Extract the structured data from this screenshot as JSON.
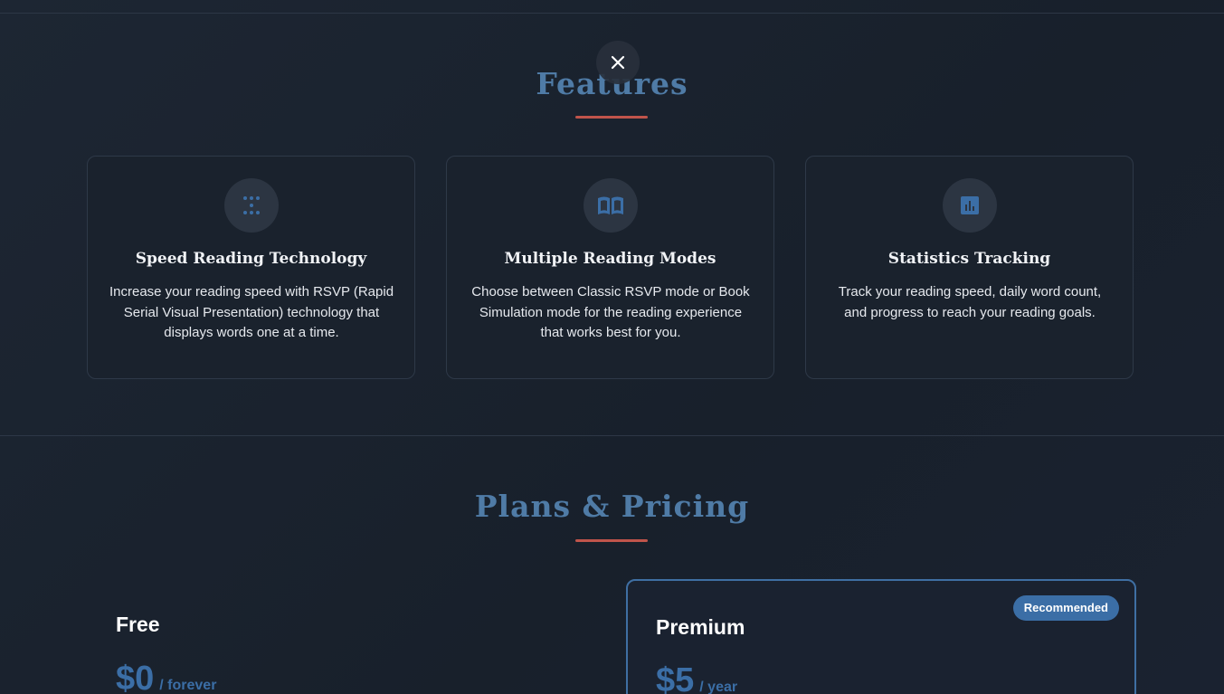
{
  "close_label": "×",
  "features": {
    "title": "Features",
    "cards": [
      {
        "icon": "grid-dots-icon",
        "title": "Speed Reading Technology",
        "description": "Increase your reading speed with RSVP (Rapid Serial Visual Presentation) technology that displays words one at a time."
      },
      {
        "icon": "book-open-icon",
        "title": "Multiple Reading Modes",
        "description": "Choose between Classic RSVP mode or Book Simulation mode for the reading experience that works best for you."
      },
      {
        "icon": "bar-chart-icon",
        "title": "Statistics Tracking",
        "description": "Track your reading speed, daily word count, and progress to reach your reading goals."
      }
    ]
  },
  "pricing": {
    "title": "Plans & Pricing",
    "plans": [
      {
        "name": "Free",
        "price": "$0",
        "period": "/ forever"
      },
      {
        "name": "Premium",
        "price": "$5",
        "period": "/ year",
        "badge": "Recommended"
      }
    ]
  },
  "colors": {
    "accent": "#3b6ea6",
    "title": "#4f7ba6",
    "underline": "#c0544b",
    "background": "#1b2330"
  }
}
